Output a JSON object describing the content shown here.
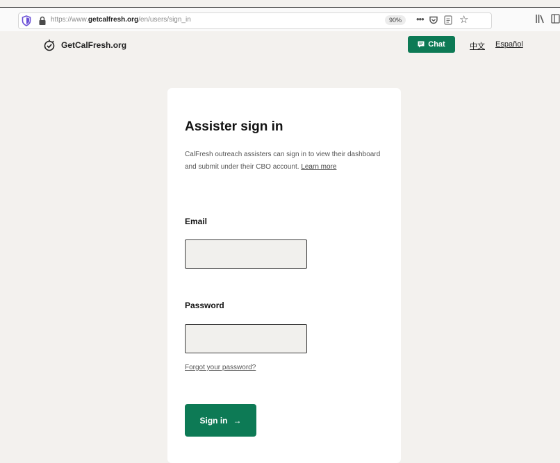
{
  "browser": {
    "url_prefix": "https://www.",
    "url_host": "getcalfresh.org",
    "url_path": "/en/users/sign_in",
    "zoom": "90%"
  },
  "header": {
    "logo_text": "GetCalFresh.org",
    "chat_label": "Chat",
    "lang_zh": "中文",
    "lang_es": "Español"
  },
  "card": {
    "title": "Assister sign in",
    "description": "CalFresh outreach assisters can sign in to view their dashboard and submit under their CBO account.",
    "learn_more": "Learn more",
    "email_label": "Email",
    "email_value": "",
    "password_label": "Password",
    "password_value": "",
    "forgot_label": "Forgot your password?",
    "signin_label": "Sign in"
  },
  "colors": {
    "brand_green": "#0d7a55",
    "page_bg": "#f3f1ee"
  }
}
